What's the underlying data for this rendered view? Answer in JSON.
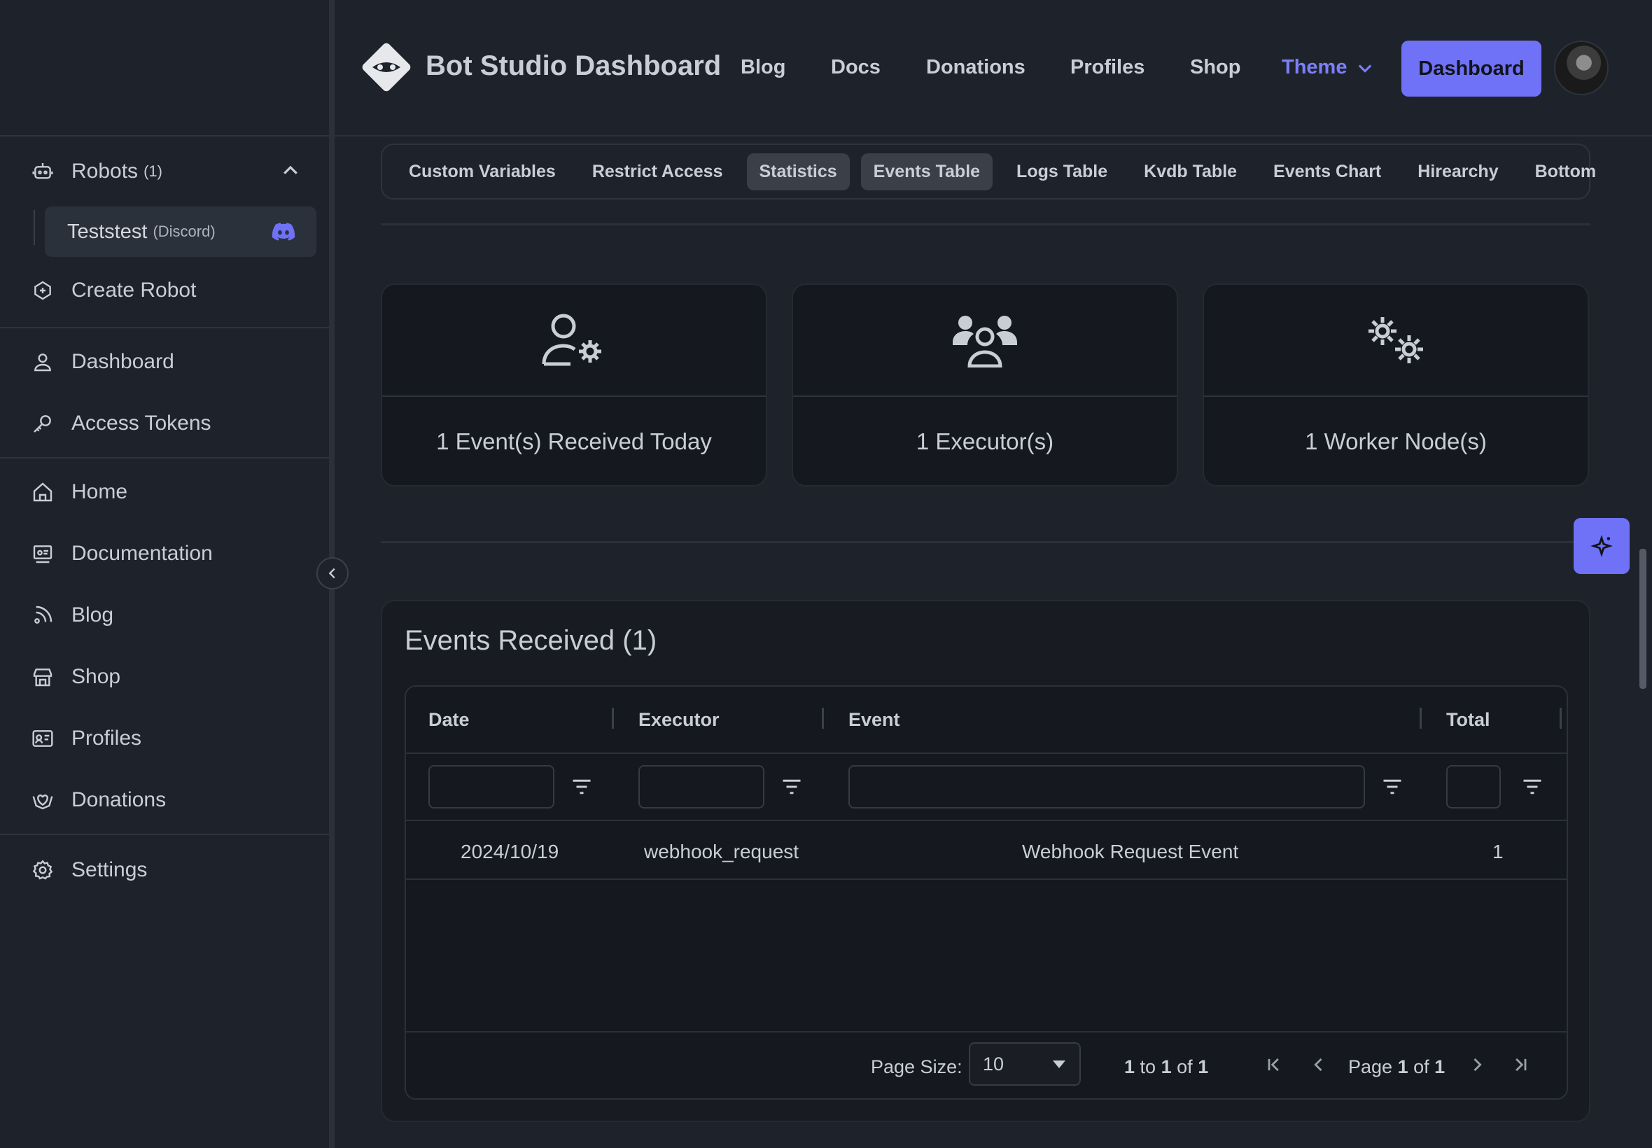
{
  "app": {
    "brand": "Bot Studio Dashboard"
  },
  "nav": {
    "links": [
      "Blog",
      "Docs",
      "Donations",
      "Profiles",
      "Shop"
    ],
    "theme_label": "Theme",
    "dashboard_button": "Dashboard"
  },
  "sidebar": {
    "robots_label": "Robots",
    "robots_count": "(1)",
    "robot_item": {
      "name": "Teststest",
      "platform": "(Discord)"
    },
    "create_robot": "Create Robot",
    "dashboard": "Dashboard",
    "access_tokens": "Access Tokens",
    "home": "Home",
    "documentation": "Documentation",
    "blog": "Blog",
    "shop": "Shop",
    "profiles": "Profiles",
    "donations": "Donations",
    "settings": "Settings"
  },
  "tabs": [
    "Custom Variables",
    "Restrict Access",
    "Statistics",
    "Events Table",
    "Logs Table",
    "Kvdb Table",
    "Events Chart",
    "Hirearchy",
    "Bottom"
  ],
  "stats": {
    "events_today": "1 Event(s) Received Today",
    "executors": "1 Executor(s)",
    "worker_nodes": "1 Worker Node(s)"
  },
  "events": {
    "title": "Events Received (1)",
    "columns": [
      "Date",
      "Executor",
      "Event",
      "Total"
    ],
    "rows": [
      {
        "date": "2024/10/19",
        "executor": "webhook_request",
        "event": "Webhook Request Event",
        "total": "1"
      }
    ],
    "pager": {
      "page_size_label": "Page Size:",
      "page_size_value": "10",
      "range_from": "1",
      "range_to_word": "to",
      "range_to": "1",
      "range_of_word": "of",
      "range_total": "1",
      "page_word": "Page",
      "page_current": "1",
      "page_of_word": "of",
      "page_total": "1"
    }
  },
  "colors": {
    "accent": "#6f72f6",
    "background": "#1e232b",
    "card": "#15181e"
  }
}
